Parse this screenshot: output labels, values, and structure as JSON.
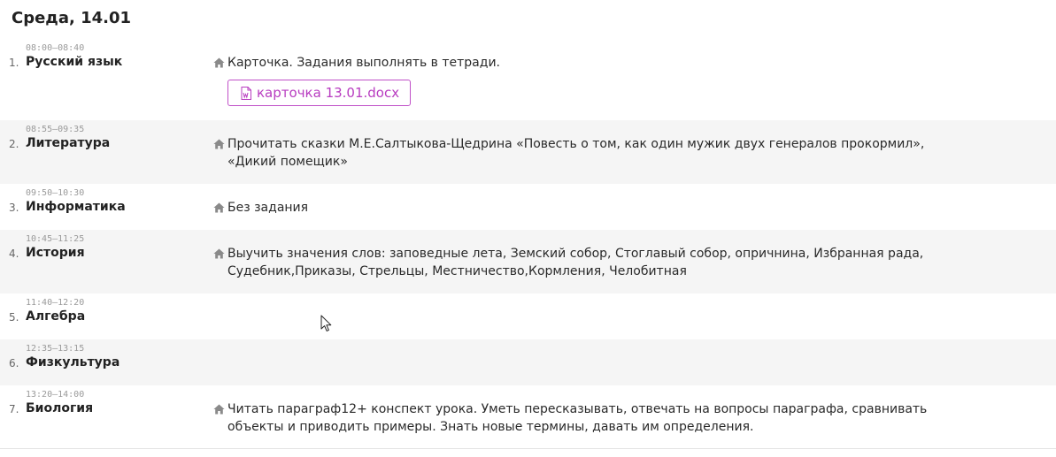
{
  "day": {
    "title": "Среда, 14.01"
  },
  "lessons": [
    {
      "number": "1.",
      "time": "08:00–08:40",
      "subject": "Русский язык",
      "homework": "Карточка. Задания выполнять в тетради.",
      "attachment": "карточка 13.01.docx"
    },
    {
      "number": "2.",
      "time": "08:55–09:35",
      "subject": "Литература",
      "homework": "Прочитать сказки М.Е.Салтыкова-Щедрина «Повесть о том, как один мужик двух генералов прокормил», «Дикий помещик»"
    },
    {
      "number": "3.",
      "time": "09:50–10:30",
      "subject": "Информатика",
      "homework": "Без задания"
    },
    {
      "number": "4.",
      "time": "10:45–11:25",
      "subject": "История",
      "homework": "Выучить значения слов: заповедные лета, Земский собор, Стоглавый собор, опричнина, Избранная рада, Судебник,Приказы, Стрельцы, Местничество,Кормления, Челобитная"
    },
    {
      "number": "5.",
      "time": "11:40–12:20",
      "subject": "Алгебра"
    },
    {
      "number": "6.",
      "time": "12:35–13:15",
      "subject": "Физкультура"
    },
    {
      "number": "7.",
      "time": "13:20–14:00",
      "subject": "Биология",
      "homework": "Читать параграф12+ конспект урока. Уметь пересказывать, отвечать на вопросы параграфа, сравнивать объекты и приводить примеры. Знать новые термины, давать им определения."
    }
  ],
  "colors": {
    "attachment_accent": "#b83cc0",
    "row_alt_background": "#f5f5f5"
  },
  "icons": {
    "homework": "home-icon",
    "attachment": "word-doc-icon"
  }
}
